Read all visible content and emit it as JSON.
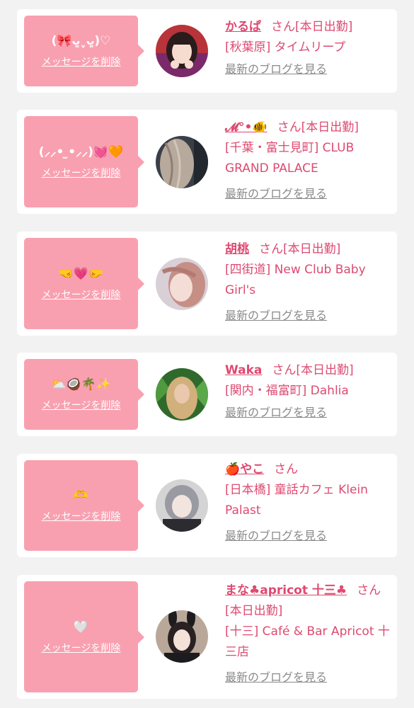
{
  "entries": [
    {
      "message": "(🎀ᴗ͈ˬᴗ͈)♡",
      "delete_label": "メッセージを削除",
      "name": "かるぱ",
      "san": "さん",
      "status": "[本日出勤]",
      "shop": "[秋葉原] タイムリープ",
      "blog_label": "最新のブログを見る"
    },
    {
      "message": "(⸝⸝• ̫•⸝⸝)💓🧡",
      "delete_label": "メッセージを削除",
      "name": "𝓜°•🐠",
      "san": "さん",
      "status": "[本日出勤]",
      "shop": "[千葉・富士見町] CLUB GRAND PALACE",
      "blog_label": "最新のブログを見る"
    },
    {
      "message": "🤜💗🤛",
      "delete_label": "メッセージを削除",
      "name": "胡桃",
      "san": "さん",
      "status": "[本日出勤]",
      "shop": "[四街道] New Club Baby Girl's",
      "blog_label": "最新のブログを見る"
    },
    {
      "message": "⛅🥥🌴✨",
      "delete_label": "メッセージを削除",
      "name": "Waka",
      "san": "さん",
      "status": "[本日出勤]",
      "shop": "[関内・福富町] Dahlia",
      "blog_label": "最新のブログを見る"
    },
    {
      "message": "🫶",
      "delete_label": "メッセージを削除",
      "name": "🍎やこ",
      "san": "さん",
      "status": "",
      "shop": "[日本橋] 童話カフェ Klein Palast",
      "blog_label": "最新のブログを見る"
    },
    {
      "message": "🤍",
      "delete_label": "メッセージを削除",
      "name": "まな♣apricot 十三♣",
      "san": "さん",
      "status": "[本日出勤]",
      "shop": "[十三] Café & Bar Apricot 十三店",
      "blog_label": "最新のブログを見る"
    }
  ],
  "colors": {
    "background": "#f2f2f2",
    "bubble": "#f9a0b0",
    "accent": "#dd4a71",
    "link_gray": "#8a8a8a"
  }
}
